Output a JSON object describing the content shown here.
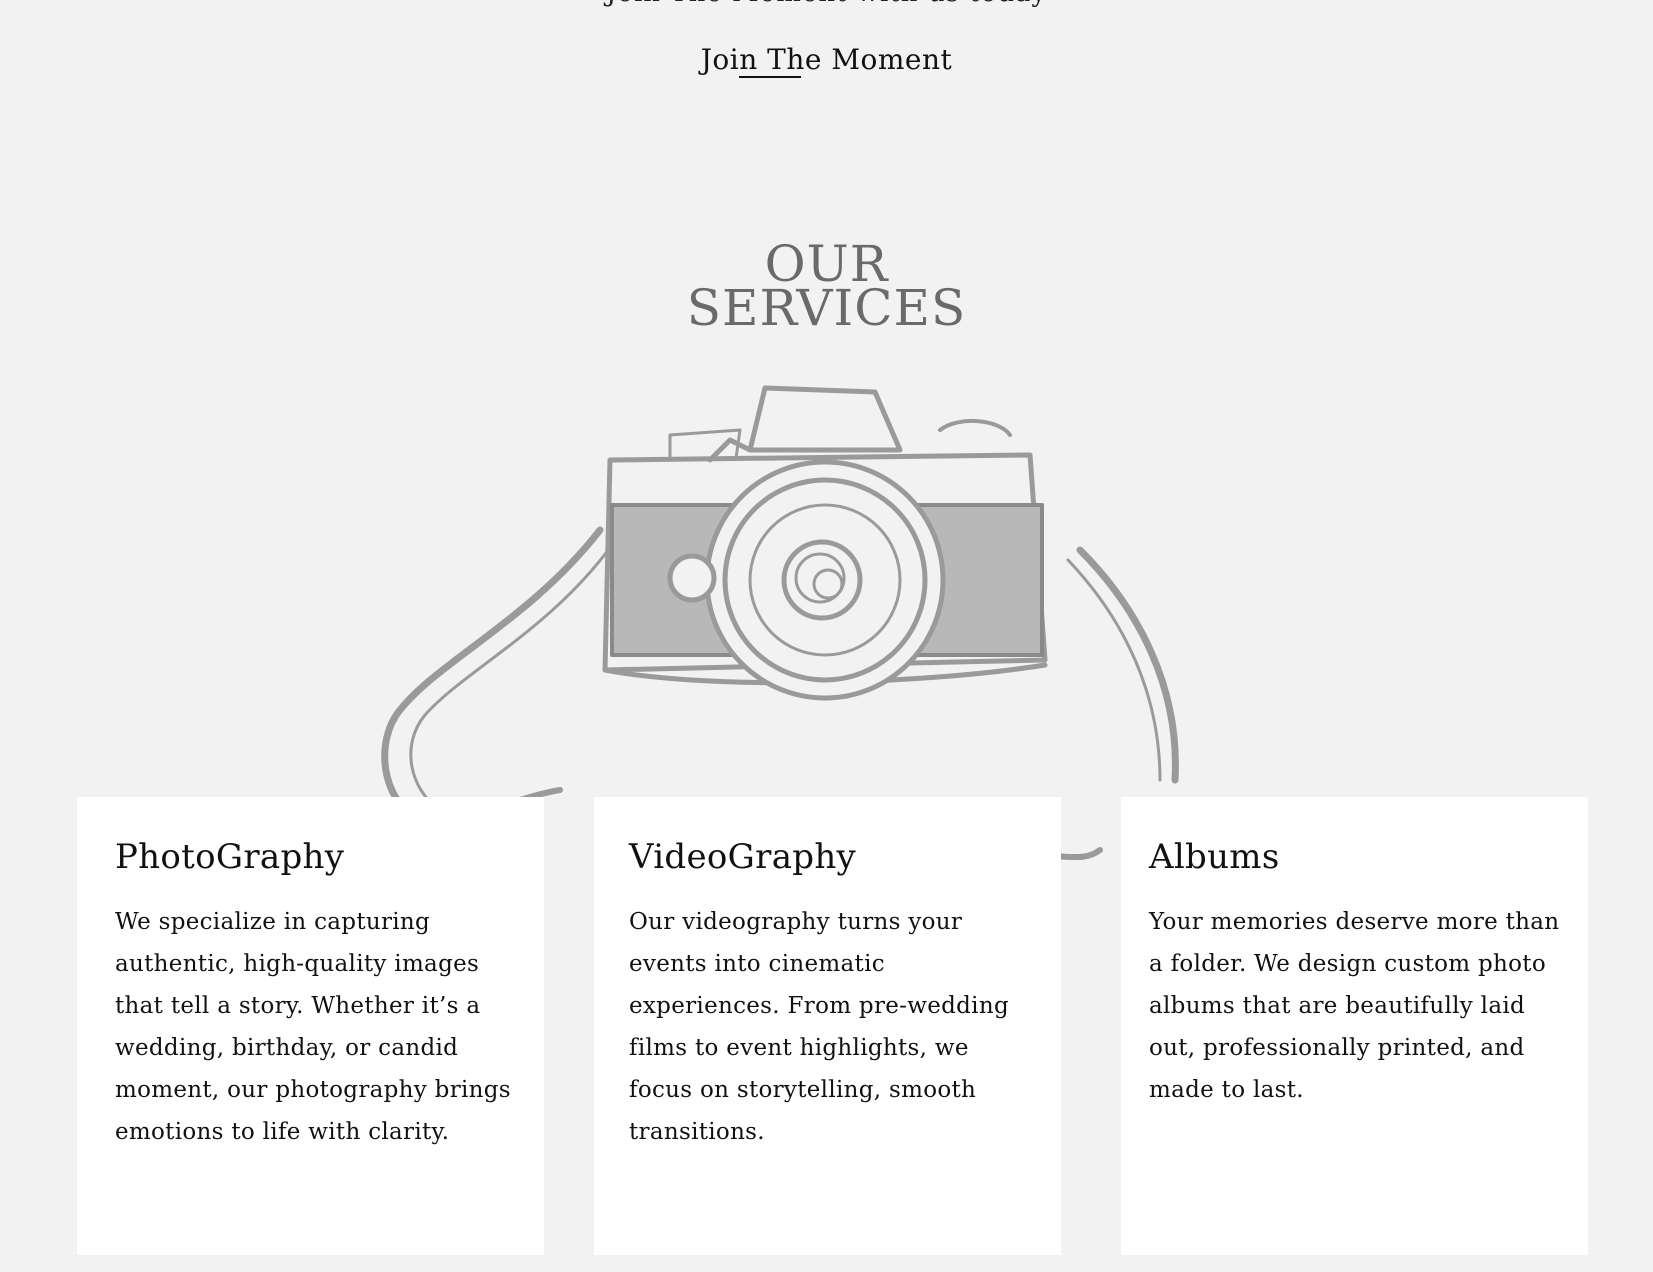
{
  "top": {
    "cut_text": "Join The Moment with us today",
    "link_label": "Join The Moment"
  },
  "services": {
    "title_line1": "OUR",
    "title_line2": "SERVICES",
    "camera_image": "camera-sketch-illustration",
    "cards": [
      {
        "title": "PhotoGraphy",
        "text": "We specialize in capturing authentic, high-quality images that tell a story. Whether it’s a wedding, birthday, or candid moment, our photography brings emotions to life with clarity."
      },
      {
        "title": "VideoGraphy",
        "text": "Our videography turns your events into cinematic experiences. From pre-wedding films to event highlights, we focus on storytelling, smooth transitions."
      },
      {
        "title": "Albums",
        "text": "Your memories deserve more than a folder. We design custom photo albums that are beautifully laid out, professionally printed, and made to last."
      }
    ]
  },
  "colors": {
    "background": "#f2f2f2",
    "card_background": "#ffffff",
    "title_gray": "#6a6a6a",
    "sketch_gray": "#9a9a9a"
  }
}
